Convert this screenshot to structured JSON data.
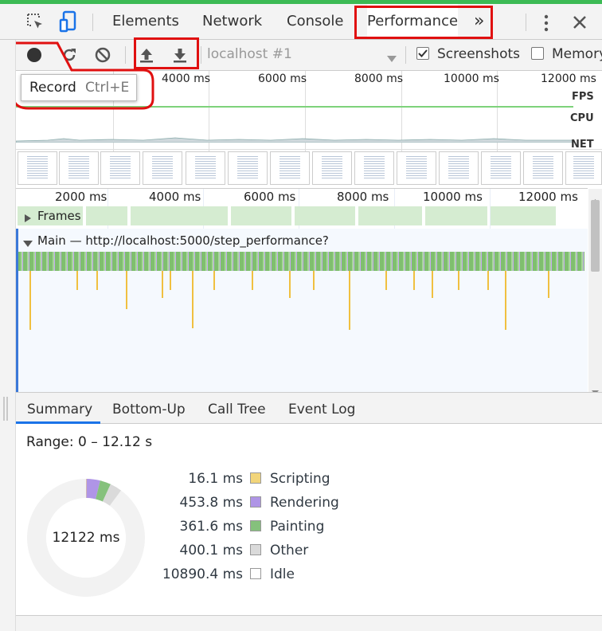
{
  "tabs": [
    {
      "label": "Elements"
    },
    {
      "label": "Network"
    },
    {
      "label": "Console"
    },
    {
      "label": "Performance"
    }
  ],
  "more_tabs_label": "»",
  "toolbar": {
    "target_select": "localhost #1",
    "screenshots_label": "Screenshots",
    "screenshots_checked": true,
    "memory_label": "Memory",
    "memory_checked": false
  },
  "tooltip": {
    "label": "Record",
    "shortcut": "Ctrl+E"
  },
  "overview": {
    "ticks": [
      "4000 ms",
      "6000 ms",
      "8000 ms",
      "10000 ms",
      "12000 ms"
    ],
    "lanes": [
      "FPS",
      "CPU",
      "NET"
    ]
  },
  "timeline": {
    "ticks": [
      "2000 ms",
      "4000 ms",
      "6000 ms",
      "8000 ms",
      "10000 ms",
      "12000 ms"
    ],
    "frames_label": "Frames",
    "main_label": "Main — http://localhost:5000/step_performance?"
  },
  "bottom_tabs": [
    {
      "label": "Summary"
    },
    {
      "label": "Bottom-Up"
    },
    {
      "label": "Call Tree"
    },
    {
      "label": "Event Log"
    }
  ],
  "summary": {
    "range": "Range: 0 – 12.12 s",
    "total": "12122 ms",
    "legend": [
      {
        "value": "16.1 ms",
        "name": "Scripting",
        "color": "#f2d57a"
      },
      {
        "value": "453.8 ms",
        "name": "Rendering",
        "color": "#af95e6"
      },
      {
        "value": "361.6 ms",
        "name": "Painting",
        "color": "#85c17c"
      },
      {
        "value": "400.1 ms",
        "name": "Other",
        "color": "#dadada"
      },
      {
        "value": "10890.4 ms",
        "name": "Idle",
        "color": "#ffffff"
      }
    ]
  },
  "chart_data": {
    "type": "pie",
    "categories": [
      "Scripting",
      "Rendering",
      "Painting",
      "Other",
      "Idle"
    ],
    "values": [
      16.1,
      453.8,
      361.6,
      400.1,
      10890.4
    ],
    "title": "",
    "total_label": "12122 ms"
  }
}
